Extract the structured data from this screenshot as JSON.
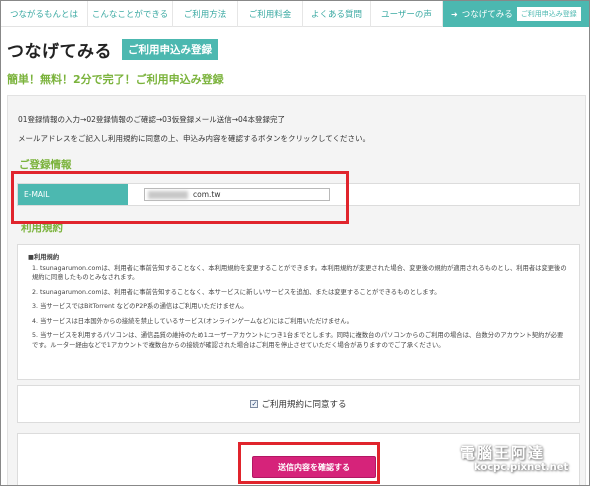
{
  "nav": {
    "items": [
      {
        "label": "つながるもんとは"
      },
      {
        "label": "こんなことができる"
      },
      {
        "label": "ご利用方法"
      },
      {
        "label": "ご利用料金"
      },
      {
        "label": "よくある質問"
      },
      {
        "label": "ユーザーの声"
      }
    ],
    "active": {
      "arrow": "➜",
      "label": "つなげてみる",
      "badge": "ご利用申込み登録"
    }
  },
  "header": {
    "title": "つなげてみる",
    "badge": "ご利用申込み登録",
    "subtitle": "簡単！無料！2分で完了！ご利用申込み登録"
  },
  "form": {
    "steps": "01登録情報の入力→02登録情報のご確認→03仮登録メール送信→04本登録完了",
    "instruction": "メールアドレスをご記入し利用規約に同意の上、申込み内容を確認するボタンをクリックしてください。",
    "section_heading": "ご登録情報",
    "email_label": "E-MAIL",
    "email_value": "com.tw",
    "terms_heading": "利用規約",
    "agree_label": "ご利用規約に同意する",
    "submit_label": "送信内容を確認する"
  },
  "terms": {
    "title": "■利用規約",
    "subtitle": "1.",
    "items": [
      "tsunagarumon.comは、利用者に事前告知することなく、本利用規約を変更することができます。本利用規約が変更された場合、変更後の規約が適用されるものとし、利用者は変更後の規約に同意したものとみなされます。",
      "2. tsunagarumon.comは、利用者に事前告知することなく、本サービスに新しいサービスを追加、または変更することができるものとします。",
      "3. 当サービスではBitTorrent などのP2P系の通信はご利用いただけません。",
      "4. 当サービスは日本国外からの接続を禁止しているサービス(オンラインゲームなど)にはご利用いただけません。",
      "5. 当サービスを利用するパソコンは、通信品質の維持のため1ユーザーアカウントにつき1台までとします。同時に複数台のパソコンからのご利用の場合は、台数分のアカウント契約が必要です。ルーター経由などで1アカウントで複数台からの接続が確認された場合はご利用を停止させていただく場合がありますのでご了承ください。"
    ]
  },
  "watermark": {
    "title": "電腦王阿達",
    "url": "kocpc.pixnet.net"
  },
  "colors": {
    "accent": "#4cb8b0",
    "green_heading": "#7bb33c",
    "submit": "#d6237a",
    "highlight": "#e0242c"
  }
}
